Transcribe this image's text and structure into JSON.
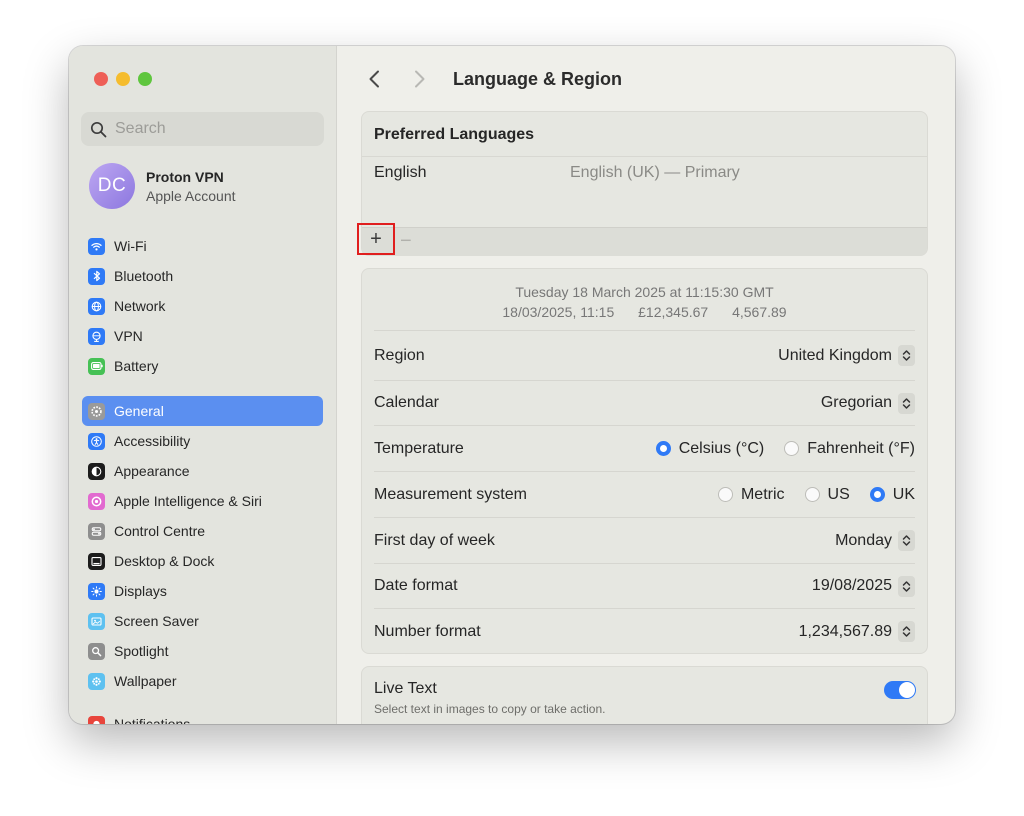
{
  "sidebar": {
    "search_placeholder": "Search",
    "account": {
      "initials": "DC",
      "name": "Proton VPN",
      "subtitle": "Apple Account"
    },
    "group1": [
      {
        "label": "Wi-Fi",
        "icon": "wifi-icon",
        "color": "#2f7af6"
      },
      {
        "label": "Bluetooth",
        "icon": "bluetooth-icon",
        "color": "#2f7af6"
      },
      {
        "label": "Network",
        "icon": "globe-icon",
        "color": "#2f7af6"
      },
      {
        "label": "VPN",
        "icon": "vpn-globe-icon",
        "color": "#2f7af6"
      },
      {
        "label": "Battery",
        "icon": "battery-icon",
        "color": "#46c155"
      }
    ],
    "group2": [
      {
        "label": "General",
        "icon": "gear-icon",
        "color": "#9a9a9a",
        "active": true
      },
      {
        "label": "Accessibility",
        "icon": "accessibility-icon",
        "color": "#2f7af6"
      },
      {
        "label": "Appearance",
        "icon": "appearance-icon",
        "color": "#1c1c1c"
      },
      {
        "label": "Apple Intelligence & Siri",
        "icon": "siri-icon",
        "color": "#e26ad0"
      },
      {
        "label": "Control Centre",
        "icon": "control-centre-icon",
        "color": "#8e8e8e"
      },
      {
        "label": "Desktop & Dock",
        "icon": "dock-icon",
        "color": "#1c1c1c"
      },
      {
        "label": "Displays",
        "icon": "sun-icon",
        "color": "#2f7af6"
      },
      {
        "label": "Screen Saver",
        "icon": "screen-saver-icon",
        "color": "#5ec1f0"
      },
      {
        "label": "Spotlight",
        "icon": "magnifier-icon",
        "color": "#8e8e8e"
      },
      {
        "label": "Wallpaper",
        "icon": "wallpaper-icon",
        "color": "#5ec1f0"
      }
    ],
    "group3": [
      {
        "label": "Notifications",
        "icon": "bell-icon",
        "color": "#e8453c"
      }
    ]
  },
  "main": {
    "title": "Language & Region",
    "preferred": {
      "heading": "Preferred Languages",
      "languages": [
        {
          "name": "English",
          "detail": "English (UK) — Primary"
        }
      ],
      "add_label": "+",
      "remove_label": "−"
    },
    "sample": {
      "date_line": "Tuesday 18 March 2025 at 11:15:30 GMT",
      "short_date": "18/03/2025, 11:15",
      "currency": "£12,345.67",
      "number": "4,567.89"
    },
    "settings": {
      "region": {
        "label": "Region",
        "value": "United Kingdom"
      },
      "calendar": {
        "label": "Calendar",
        "value": "Gregorian"
      },
      "temperature": {
        "label": "Temperature",
        "options": [
          {
            "label": "Celsius (°C)",
            "selected": true
          },
          {
            "label": "Fahrenheit (°F)",
            "selected": false
          }
        ]
      },
      "measurement": {
        "label": "Measurement system",
        "options": [
          {
            "label": "Metric",
            "selected": false
          },
          {
            "label": "US",
            "selected": false
          },
          {
            "label": "UK",
            "selected": true
          }
        ]
      },
      "first_day": {
        "label": "First day of week",
        "value": "Monday"
      },
      "date_format": {
        "label": "Date format",
        "value": "19/08/2025"
      },
      "number_format": {
        "label": "Number format",
        "value": "1,234,567.89"
      }
    },
    "live_text": {
      "title": "Live Text",
      "subtitle": "Select text in images to copy or take action.",
      "enabled": true
    }
  },
  "colors": {
    "accent": "#2f7af6",
    "sidebar_selected": "#5b8ff0",
    "highlight_box": "#e01e1e"
  }
}
